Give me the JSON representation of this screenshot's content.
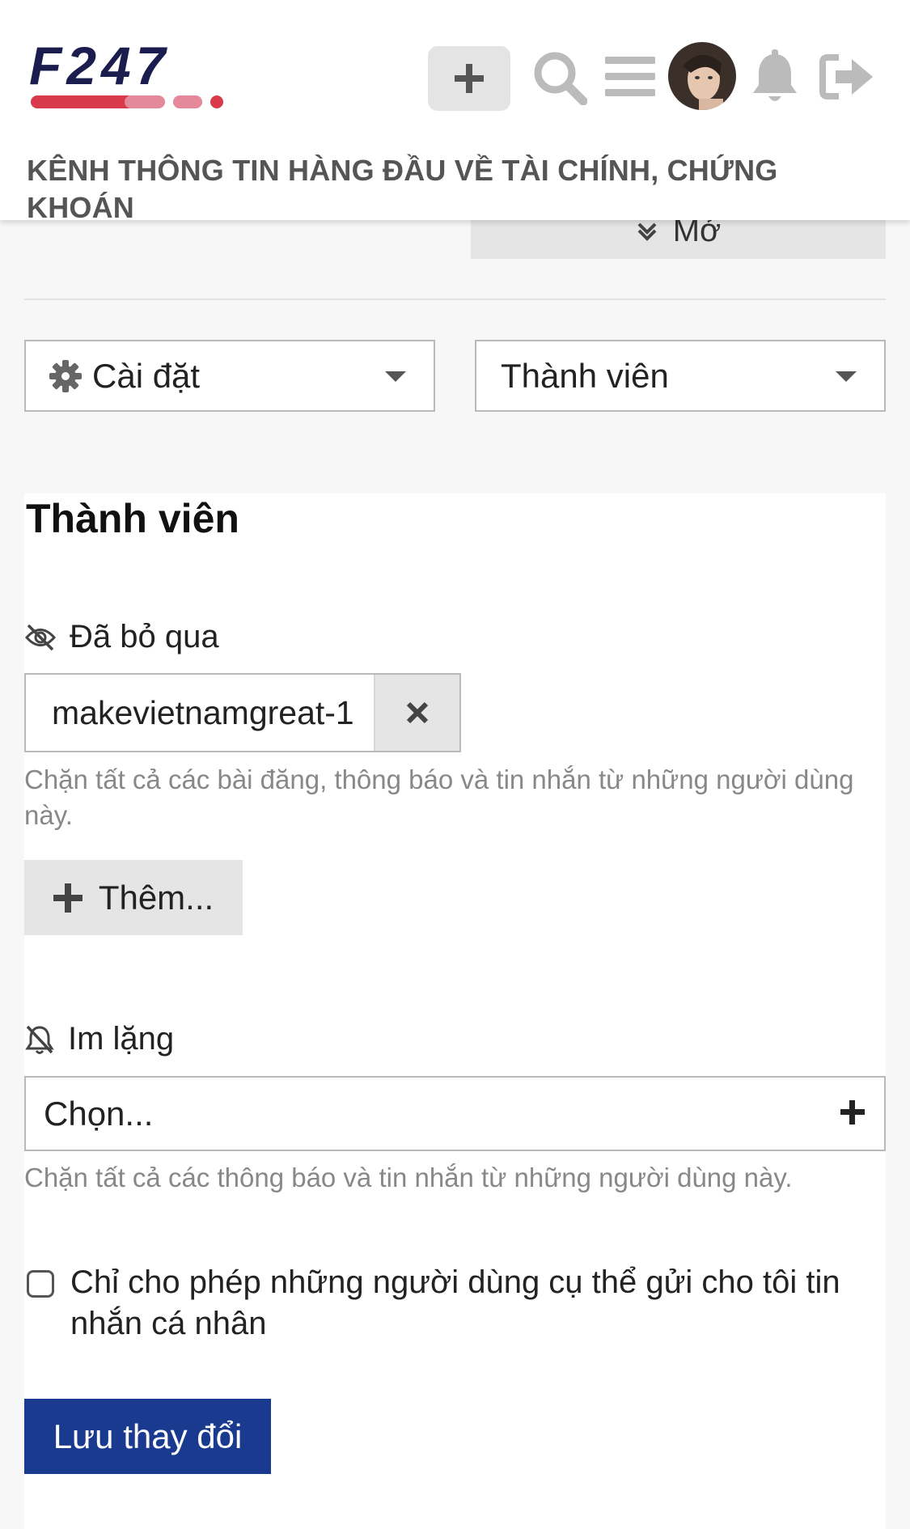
{
  "header": {
    "logo_text": "F247",
    "tagline": "KÊNH THÔNG TIN HÀNG ĐẦU VỀ TÀI CHÍNH, CHỨNG KHOÁN",
    "icons": [
      "plus-icon",
      "search-icon",
      "menu-icon",
      "avatar",
      "bell-icon",
      "logout-icon"
    ]
  },
  "partial_button": {
    "label": "Mở"
  },
  "dropdowns": {
    "settings": {
      "label": "Cài đặt",
      "icon": "gear-icon"
    },
    "section": {
      "label": "Thành viên"
    }
  },
  "main": {
    "title": "Thành viên",
    "ignored": {
      "label": "Đã bỏ qua",
      "icon": "eye-slash-icon",
      "users": [
        "makevietnamgreat-1"
      ],
      "hint": "Chặn tất cả các bài đăng, thông báo và tin nhắn từ những người dùng này.",
      "add_label": "Thêm..."
    },
    "muted": {
      "label": "Im lặng",
      "icon": "bell-slash-icon",
      "placeholder": "Chọn...",
      "hint": "Chặn tất cả các thông báo và tin nhắn từ những người dùng này."
    },
    "allow_pm_only": {
      "label": "Chỉ cho phép những người dùng cụ thể gửi cho tôi tin nhắn cá nhân",
      "checked": false
    },
    "save_label": "Lưu thay đổi"
  },
  "colors": {
    "primary": "#1a3a8f",
    "logo_navy": "#1c1d4f",
    "logo_red": "#d93a4b",
    "logo_pink": "#e4899a"
  }
}
